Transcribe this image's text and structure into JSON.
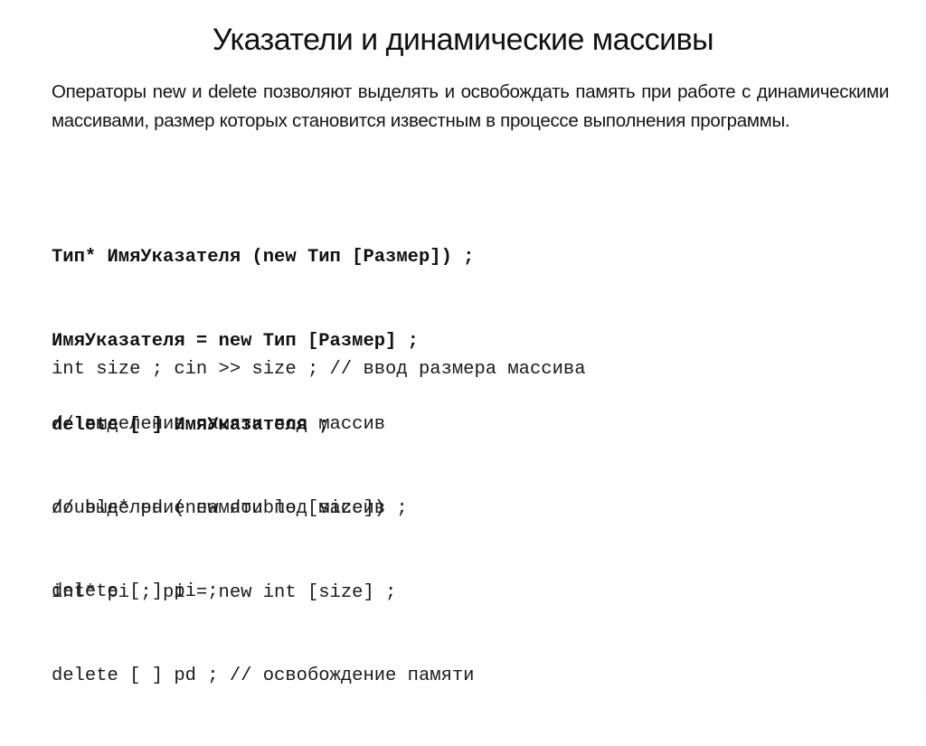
{
  "slide": {
    "title": "Указатели и динамические массивы",
    "intro": "Операторы new и delete позволяют выделять и освобождать память при работе с динамическими массивами, размер которых становится известным в процессе выполнения программы.",
    "syntax_lines": [
      "Тип* ИмяУказателя (new Тип [Размер]) ;",
      "ИмяУказателя = new Тип [Размер] ;",
      "delete [ ] ИмяУказателя ;"
    ],
    "code_block_1": [
      "int size ; cin >> size ; // ввод размера массива"
    ],
    "code_block_2": [
      "// выделение памяти под массив",
      "double* pd (new double [size]) ;"
    ],
    "code_block_3": [
      "// выделение памяти под массив",
      "int* pi ; pi = new int [size] ;"
    ],
    "code_block_4": [
      "delete [ ] pi ;",
      "delete [ ] pd ; // освобождение памяти"
    ]
  }
}
